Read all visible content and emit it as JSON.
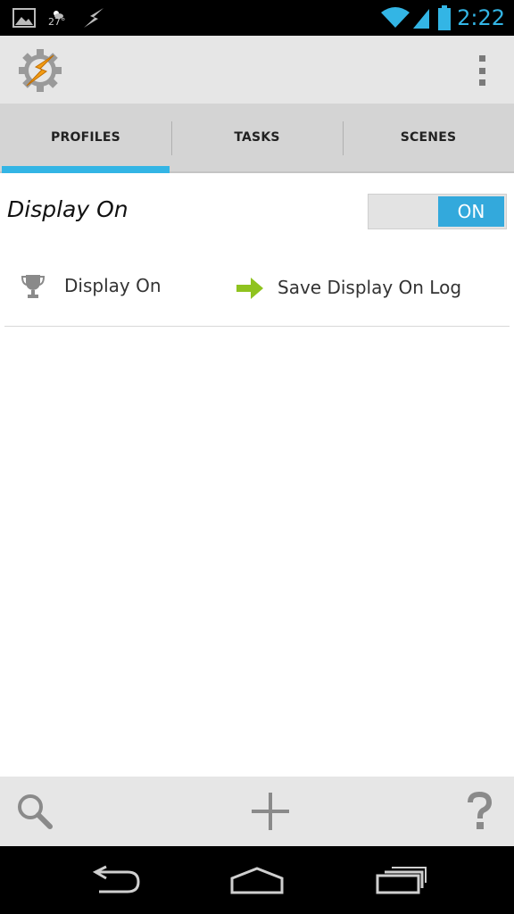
{
  "status_bar": {
    "weather_temp": "27°",
    "time": "2:22",
    "icons": [
      "gallery-icon",
      "weather-icon",
      "flash-icon",
      "wifi-icon",
      "signal-icon",
      "battery-icon"
    ]
  },
  "action_bar": {
    "logo": "tasker-gear-icon",
    "menu": "overflow-menu-icon"
  },
  "tabs": [
    {
      "label": "PROFILES",
      "active": true
    },
    {
      "label": "TASKS",
      "active": false
    },
    {
      "label": "SCENES",
      "active": false
    }
  ],
  "profile": {
    "name": "Display On",
    "toggle_label": "ON",
    "context": {
      "icon": "trophy-icon",
      "label": "Display On"
    },
    "task": {
      "icon": "arrow-right-icon",
      "label": "Save Display On Log"
    }
  },
  "bottom_bar": {
    "icons": [
      "search-icon",
      "add-icon",
      "help-icon"
    ]
  },
  "nav_bar": {
    "icons": [
      "back-icon",
      "home-icon",
      "recent-apps-icon"
    ]
  },
  "colors": {
    "accent": "#33b5e5",
    "toggle_on": "#33a9dc",
    "task_arrow": "#8fc31f"
  }
}
